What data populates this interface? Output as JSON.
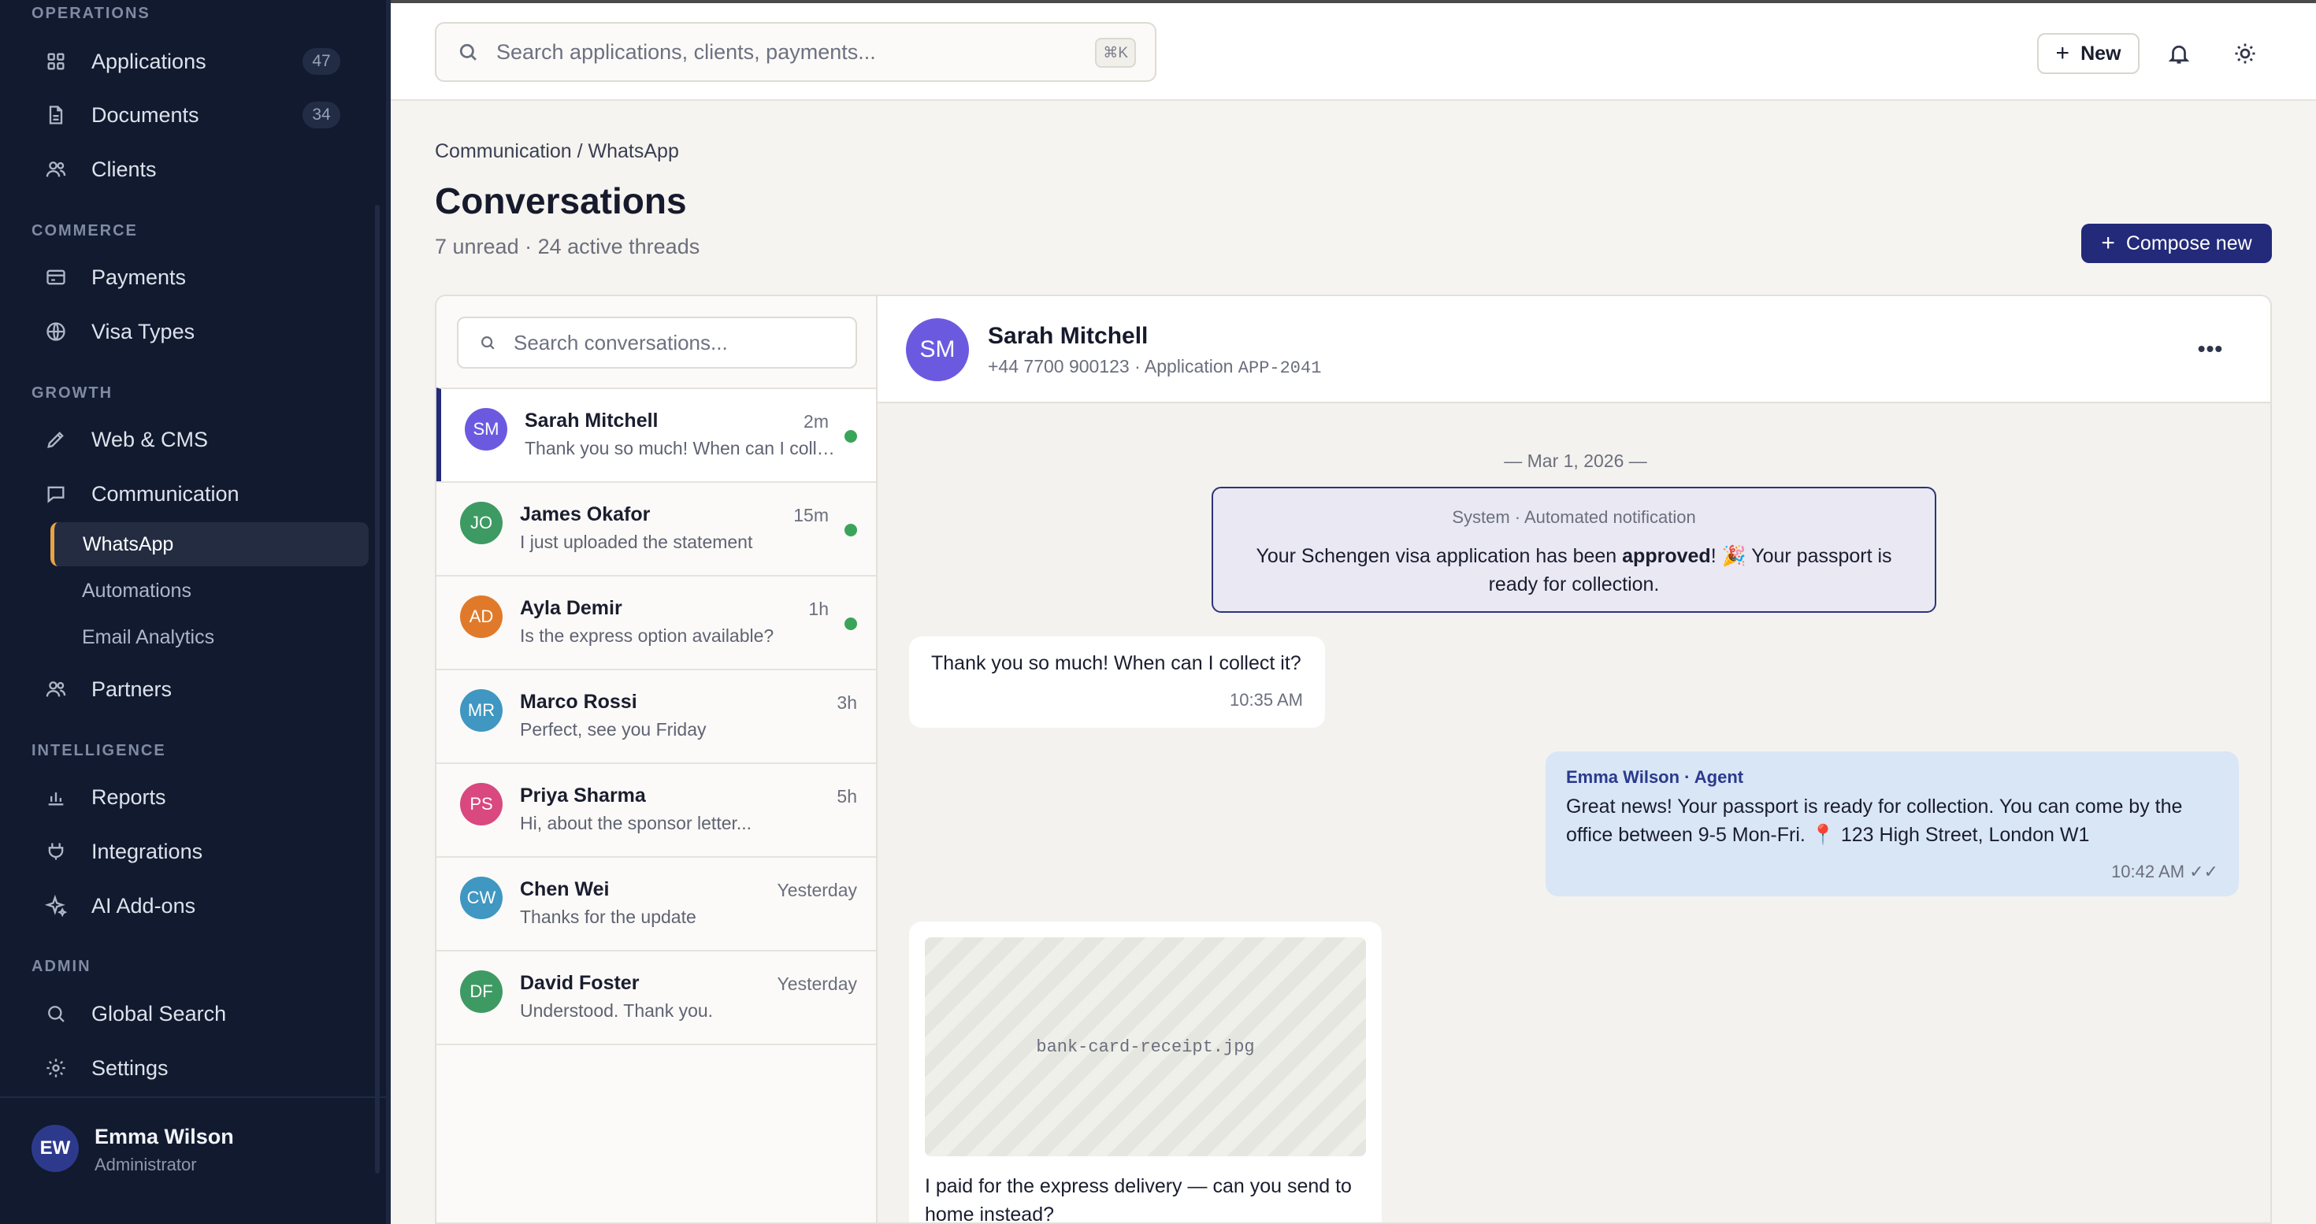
{
  "sidebar": {
    "sections": {
      "operations": "OPERATIONS",
      "commerce": "COMMERCE",
      "growth": "GROWTH",
      "intelligence": "INTELLIGENCE",
      "admin": "ADMIN"
    },
    "items": {
      "applications": {
        "label": "Applications",
        "count": "47",
        "icon": "grid-icon"
      },
      "documents": {
        "label": "Documents",
        "count": "34",
        "icon": "document-icon"
      },
      "clients": {
        "label": "Clients",
        "icon": "users-icon"
      },
      "payments": {
        "label": "Payments",
        "icon": "credit-card-icon"
      },
      "visa_types": {
        "label": "Visa Types",
        "icon": "globe-icon"
      },
      "web_cms": {
        "label": "Web & CMS",
        "icon": "pencil-icon"
      },
      "communication": {
        "label": "Communication",
        "icon": "chat-icon"
      },
      "whatsapp": {
        "label": "WhatsApp"
      },
      "automations": {
        "label": "Automations"
      },
      "email_analytics": {
        "label": "Email Analytics"
      },
      "partners": {
        "label": "Partners",
        "icon": "users-icon"
      },
      "reports": {
        "label": "Reports",
        "icon": "bar-chart-icon"
      },
      "integrations": {
        "label": "Integrations",
        "icon": "plug-icon"
      },
      "ai_addons": {
        "label": "AI Add-ons",
        "icon": "sparkle-icon"
      },
      "global_search": {
        "label": "Global Search",
        "icon": "search-icon"
      },
      "settings": {
        "label": "Settings",
        "icon": "gear-icon"
      }
    },
    "user": {
      "initials": "EW",
      "name": "Emma Wilson",
      "role": "Administrator"
    }
  },
  "topbar": {
    "search_placeholder": "Search applications, clients, payments...",
    "shortcut": "⌘K",
    "new_label": "New"
  },
  "header": {
    "breadcrumb": "Communication / WhatsApp",
    "title": "Conversations",
    "subtitle": "7 unread · 24 active threads",
    "compose_label": "Compose new"
  },
  "conversations": {
    "search_placeholder": "Search conversations...",
    "items": [
      {
        "initials": "SM",
        "name": "Sarah Mitchell",
        "time": "2m",
        "preview": "Thank you so much! When can I collect it?",
        "color": "#6b5ae0",
        "online": true
      },
      {
        "initials": "JO",
        "name": "James Okafor",
        "time": "15m",
        "preview": "I just uploaded the statement",
        "color": "#3e9a63",
        "online": true
      },
      {
        "initials": "AD",
        "name": "Ayla Demir",
        "time": "1h",
        "preview": "Is the express option available?",
        "color": "#e07a2a",
        "online": true
      },
      {
        "initials": "MR",
        "name": "Marco Rossi",
        "time": "3h",
        "preview": "Perfect, see you Friday",
        "color": "#3f97c2",
        "online": false
      },
      {
        "initials": "PS",
        "name": "Priya Sharma",
        "time": "5h",
        "preview": "Hi, about the sponsor letter...",
        "color": "#d9487f",
        "online": false
      },
      {
        "initials": "CW",
        "name": "Chen Wei",
        "time": "Yesterday",
        "preview": "Thanks for the update",
        "color": "#3f97c2",
        "online": false
      },
      {
        "initials": "DF",
        "name": "David Foster",
        "time": "Yesterday",
        "preview": "Understood. Thank you.",
        "color": "#3e9a63",
        "online": false
      }
    ]
  },
  "chat": {
    "contact": {
      "initials": "SM",
      "name": "Sarah Mitchell",
      "phone": "+44 7700 900123 · Application ",
      "application": "APP-2041"
    },
    "more_label": "•••",
    "date_separator": "— Mar 1, 2026 —",
    "system": {
      "title": "System · Automated notification",
      "text_before": "Your Schengen visa application has been ",
      "text_bold": "approved",
      "text_after": "! 🎉 Your passport is ready for collection."
    },
    "incoming": {
      "text": "Thank you so much! When can I collect it?",
      "time": "10:35 AM"
    },
    "outgoing": {
      "author": "Emma Wilson · Agent",
      "text": "Great news! Your passport is ready for collection. You can come by the office between 9-5 Mon-Fri. 📍 123 High Street, London W1",
      "time": "10:42 AM ✓✓"
    },
    "attachment": {
      "file_name": "bank-card-receipt.jpg",
      "text": "I paid for the express delivery — can you send to home instead?"
    }
  }
}
